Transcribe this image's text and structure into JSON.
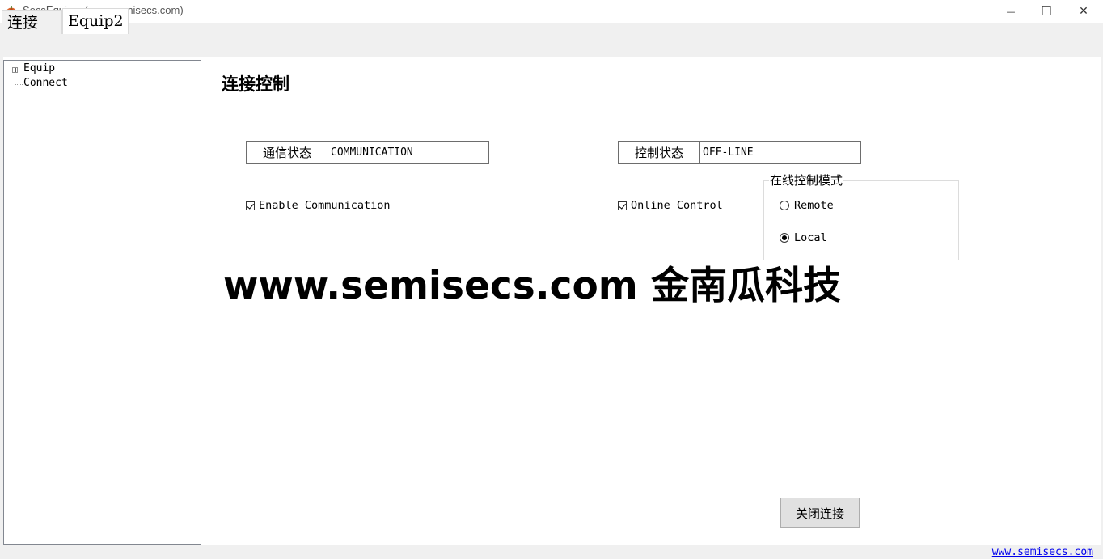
{
  "window": {
    "title": "SecsEquip    (www.semisecs.com)",
    "minimize_glyph": "—",
    "maximize_glyph": "☐",
    "close_glyph": "✕"
  },
  "tabs": [
    {
      "label": "连接",
      "selected": false
    },
    {
      "label": "Equip2",
      "selected": true
    }
  ],
  "tree": {
    "root": {
      "label": "Equip",
      "expander": "+"
    },
    "child": {
      "label": "Connect"
    }
  },
  "main": {
    "heading": "连接控制",
    "comm_status": {
      "label": "通信状态",
      "value": "COMMUNICATION"
    },
    "control_status": {
      "label": "控制状态",
      "value": "OFF-LINE"
    },
    "enable_communication": {
      "label": "Enable Communication",
      "checked": true
    },
    "online_control": {
      "label": "Online Control",
      "checked": true
    },
    "online_mode_group": {
      "legend": "在线控制模式",
      "options": [
        {
          "label": "Remote",
          "selected": false
        },
        {
          "label": "Local",
          "selected": true
        }
      ]
    },
    "watermark": "www.semisecs.com 金南瓜科技",
    "close_button_label": "关闭连接"
  },
  "footer": {
    "link_text": "www.semisecs.com"
  },
  "colors": {
    "link": "#0000ee",
    "button_bg": "#e1e1e1",
    "tab_bar_bg": "#f0f0f0"
  }
}
